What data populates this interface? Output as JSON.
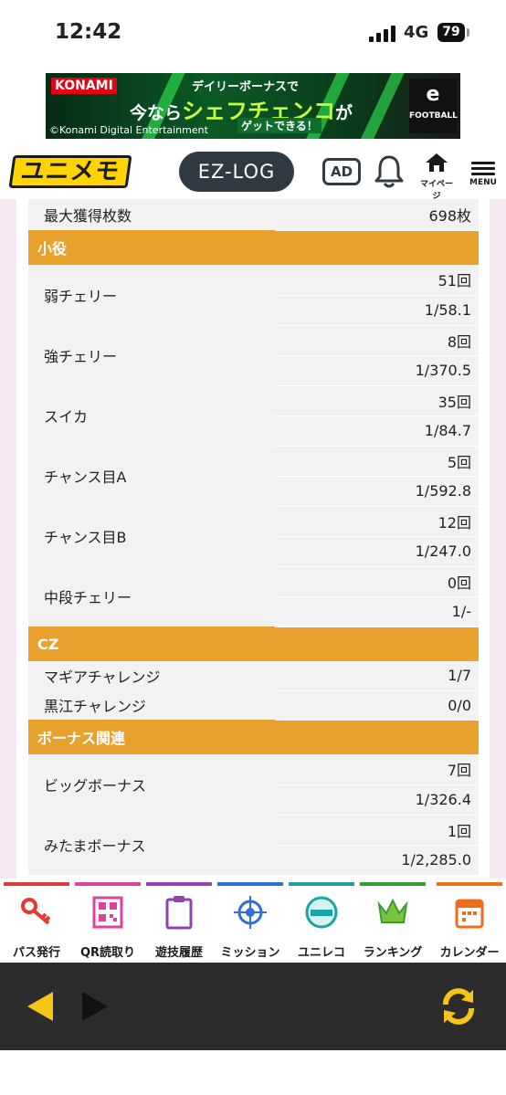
{
  "status_bar": {
    "time": "12:42",
    "network": "4G",
    "battery": "79"
  },
  "ad_banner": {
    "brand": "KONAMI",
    "line1": "デイリーボーナスで",
    "line2_prefix": "今なら",
    "line2_highlight": "シェフチェンコ",
    "line2_suffix": "が",
    "line3": "ゲットできる！",
    "copyright": "©Konami Digital Entertainment",
    "product": "FOOTBALL",
    "product_mark": "e"
  },
  "header": {
    "logo": "ユニメモ",
    "ezlog": "EZ-LOG",
    "ad": "AD",
    "mypage": "マイページ",
    "menu": "MENU"
  },
  "stats": {
    "top_row": {
      "label": "最大獲得枚数",
      "value": "698枚"
    },
    "sections": [
      {
        "title": "小役",
        "rows": [
          {
            "label": "弱チェリー",
            "count": "51回",
            "prob": "1/58.1"
          },
          {
            "label": "強チェリー",
            "count": "8回",
            "prob": "1/370.5"
          },
          {
            "label": "スイカ",
            "count": "35回",
            "prob": "1/84.7"
          },
          {
            "label": "チャンス目A",
            "count": "5回",
            "prob": "1/592.8"
          },
          {
            "label": "チャンス目B",
            "count": "12回",
            "prob": "1/247.0"
          },
          {
            "label": "中段チェリー",
            "count": "0回",
            "prob": "1/-"
          }
        ]
      },
      {
        "title": "CZ",
        "rows": [
          {
            "label": "マギアチャレンジ",
            "value": "1/7"
          },
          {
            "label": "黒江チャレンジ",
            "value": "0/0"
          }
        ]
      },
      {
        "title": "ボーナス関連",
        "rows": [
          {
            "label": "ビッグボーナス",
            "count": "7回",
            "prob": "1/326.4"
          },
          {
            "label": "みたまボーナス",
            "count": "1回",
            "prob": "1/2,285.0"
          }
        ]
      }
    ]
  },
  "tabbar": {
    "items": [
      {
        "label": "パス発行",
        "color": "#e53935"
      },
      {
        "label": "QR読取り",
        "color": "#e040a0"
      },
      {
        "label": "遊技履歴",
        "color": "#8e44ad"
      },
      {
        "label": "ミッション",
        "color": "#2f6fd6"
      },
      {
        "label": "ユニレコ",
        "color": "#1aa5a5"
      },
      {
        "label": "ランキング",
        "color": "#3a9b2e"
      },
      {
        "label": "カレンダー",
        "color": "#ef6c1a"
      }
    ]
  },
  "colors": {
    "section_header": "#e9a12d",
    "browser_bar": "#2c2c2c",
    "nav_yellow": "#f5c518"
  }
}
